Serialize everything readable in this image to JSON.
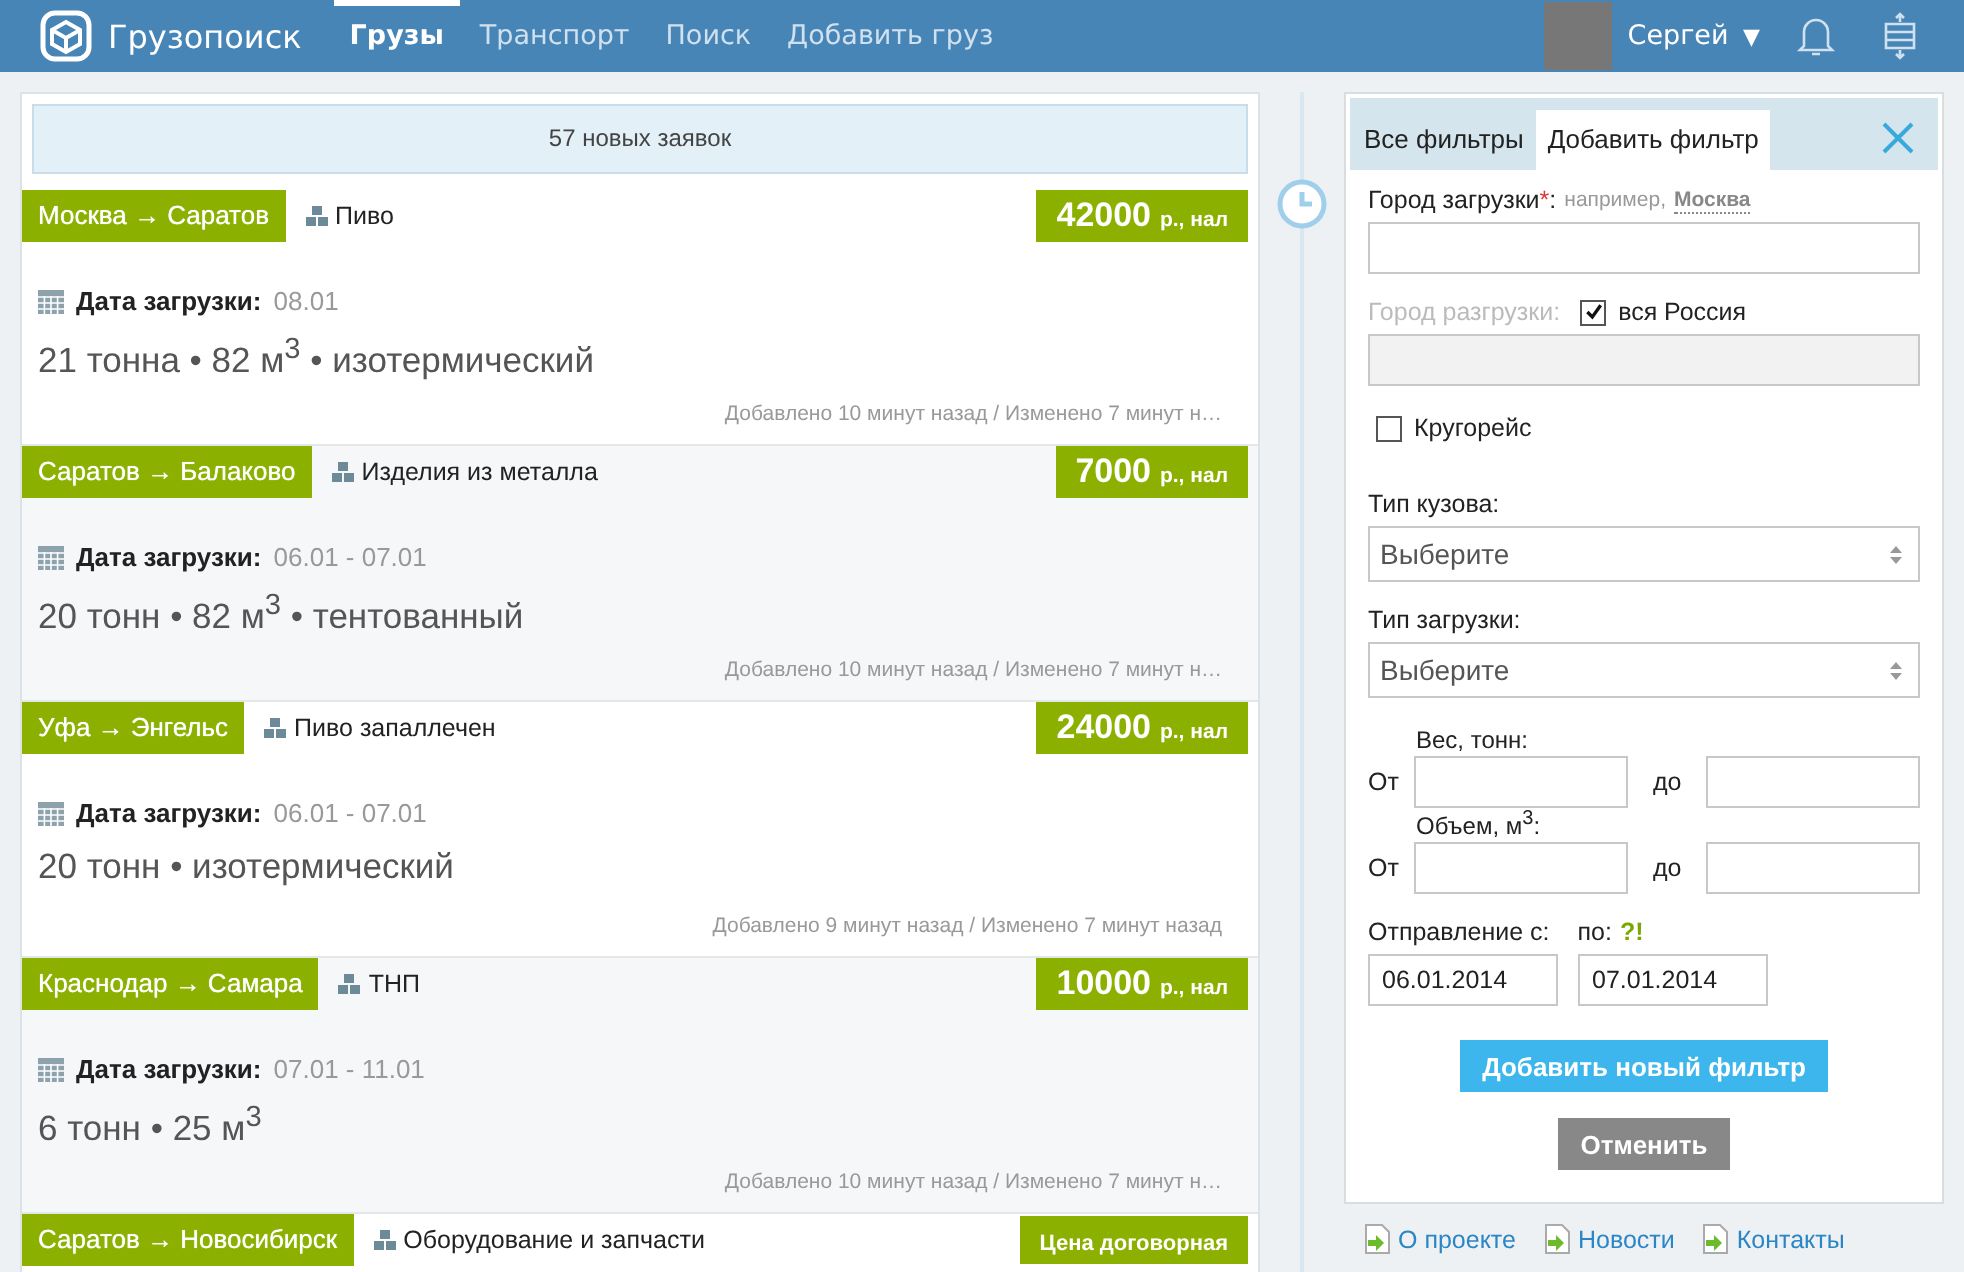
{
  "header": {
    "logo": "Грузопоиск",
    "nav": [
      {
        "label": "Грузы",
        "selected": true
      },
      {
        "label": "Транспорт",
        "selected": false
      },
      {
        "label": "Поиск",
        "selected": false
      },
      {
        "label": "Добавить груз",
        "selected": false
      }
    ],
    "user": {
      "name": "Сергей",
      "caret": "▼"
    }
  },
  "feed": {
    "new_notice": "57 новых заявок",
    "cards": [
      {
        "route": "Москва → Саратов",
        "cargo": "Пиво",
        "price": {
          "kind": "fixed",
          "amount": "42000",
          "unit": "р., нал"
        },
        "date_label": "Дата загрузки:",
        "date": "08.01",
        "specs": "21 тонна • 82 м$^{3}$ • изотермический",
        "meta": "Добавлено 10 минут назад / Изменено 7 минут н…"
      },
      {
        "route": "Саратов → Балаково",
        "cargo": "Изделия из металла",
        "price": {
          "kind": "fixed",
          "amount": "7000",
          "unit": "р., нал"
        },
        "date_label": "Дата загрузки:",
        "date": "06.01 - 07.01",
        "specs": "20 тонн • 82 м$^{3}$ • тентованный",
        "meta": "Добавлено 10 минут назад / Изменено 7 минут н…"
      },
      {
        "route": "Уфа → Энгельс",
        "cargo": "Пиво запаллечен",
        "price": {
          "kind": "fixed",
          "amount": "24000",
          "unit": "р., нал"
        },
        "date_label": "Дата загрузки:",
        "date": "06.01 - 07.01",
        "specs": "20 тонн • изотермический",
        "meta": "Добавлено 9 минут назад / Изменено 7 минут назад"
      },
      {
        "route": "Краснодар → Самара",
        "cargo": "ТНП",
        "price": {
          "kind": "fixed",
          "amount": "10000",
          "unit": "р., нал"
        },
        "date_label": "Дата загрузки:",
        "date": "07.01 - 11.01",
        "specs": "6 тонн • 25 м$^{3}$",
        "meta": "Добавлено 10 минут назад / Изменено 7 минут н…"
      },
      {
        "route": "Саратов → Новосибирск",
        "cargo": "Оборудование и запчасти",
        "price": {
          "kind": "negotiable",
          "text": "Цена договорная"
        }
      }
    ]
  },
  "filter_panel": {
    "tabs": [
      {
        "label": "Все фильтры",
        "selected": false
      },
      {
        "label": "Добавить фильтр",
        "selected": true
      }
    ],
    "load_city": {
      "label": "Город загрузки",
      "required_mark": "*",
      "label_suffix": ":",
      "hint": "например,",
      "example": "Москва"
    },
    "unload_city": {
      "label": "Город разгрузки:",
      "disabled": true,
      "all_russia": {
        "label": "вся Россия",
        "checked": true
      }
    },
    "round_trip": {
      "label": "Кругорейс",
      "checked": false
    },
    "body_type": {
      "label": "Тип кузова:",
      "value": "Выберите"
    },
    "load_type": {
      "label": "Тип загрузки:",
      "value": "Выберите"
    },
    "weight": {
      "label": "Вес, тонн:",
      "from": "От",
      "to": "до"
    },
    "volume": {
      "label": "Объем, м$^{3}$:",
      "from": "От",
      "to": "до"
    },
    "dates": {
      "from_label": "Отправление с:",
      "to_label": "по:",
      "help": "?!",
      "from": "06.01.2014",
      "to": "07.01.2014"
    },
    "buttons": [
      {
        "kind": "primary",
        "label": "Добавить новый фильтр"
      },
      {
        "kind": "secondary",
        "label": "Отменить"
      }
    ]
  },
  "footer_links": [
    "О проекте",
    "Новости",
    "Контакты"
  ]
}
